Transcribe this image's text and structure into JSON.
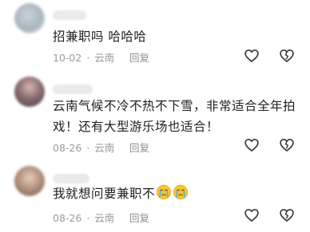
{
  "comments": [
    {
      "text": "招兼职吗 哈哈哈",
      "date": "10-02",
      "separator": "·",
      "location": "云南",
      "reply_label": "回复",
      "like_icon": "heart-outline-icon",
      "dislike_icon": "broken-heart-icon"
    },
    {
      "text": "云南气候不冷不热不下雪，非常适合全年拍戏！还有大型游乐场也适合！",
      "date": "08-26",
      "separator": "·",
      "location": "云南",
      "reply_label": "回复",
      "like_icon": "heart-outline-icon",
      "dislike_icon": "broken-heart-icon"
    },
    {
      "text": "我就想问要兼职不",
      "emoji": [
        "crying-face-emoji",
        "crying-face-emoji"
      ],
      "date": "08-26",
      "separator": "·",
      "location": "云南",
      "reply_label": "回复",
      "like_icon": "heart-outline-icon",
      "dislike_icon": "broken-heart-icon"
    }
  ],
  "colors": {
    "text": "#202020",
    "meta": "#9a9a9a",
    "icon": "#3a3a3a",
    "emoji": "#f7c531"
  }
}
